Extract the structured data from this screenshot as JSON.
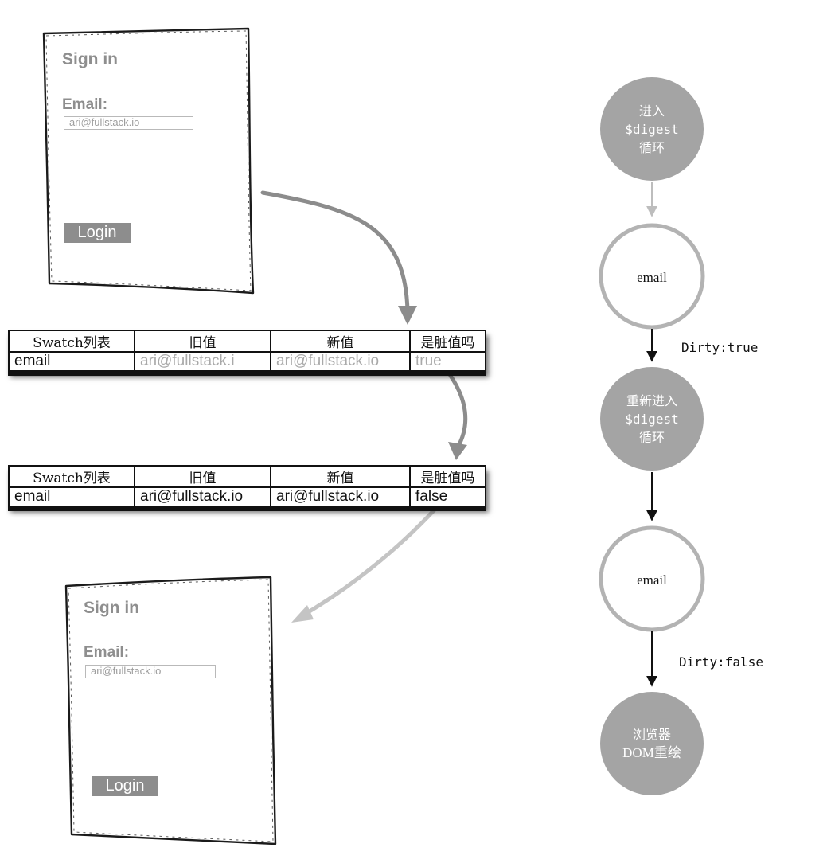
{
  "mockups": {
    "before": {
      "title": "Sign in",
      "email_label": "Email:",
      "email_value": "ari@fullstack.io",
      "login_label": "Login"
    },
    "after": {
      "title": "Sign in",
      "email_label": "Email:",
      "email_value": "ari@fullstack.io",
      "login_label": "Login"
    }
  },
  "tables": {
    "headers": [
      "Swatch列表",
      "旧值",
      "新值",
      "是脏值吗"
    ],
    "first": {
      "cells": [
        "email",
        "ari@fullstack.i",
        "ari@fullstack.io",
        "true"
      ]
    },
    "second": {
      "cells": [
        "email",
        "ari@fullstack.io",
        "ari@fullstack.io",
        "false"
      ]
    }
  },
  "flow": {
    "node1": {
      "line1": "进入",
      "line2": "$digest",
      "line3": "循环"
    },
    "node2": {
      "label": "email"
    },
    "edge2_label": "Dirty:true",
    "node3": {
      "line1": "重新进入",
      "line2": "$digest",
      "line3": "循环"
    },
    "node4": {
      "label": "email"
    },
    "edge4_label": "Dirty:false",
    "node5": {
      "line1": "浏览器",
      "line2": "DOM重绘"
    }
  },
  "colors": {
    "node_fill": "#a4a4a4",
    "node_outline": "#b3b3b3",
    "curve_dark": "#8c8c8c",
    "curve_light": "#c4c4c4",
    "edge_light": "#bdbdbd",
    "edge_dark": "#111111"
  }
}
